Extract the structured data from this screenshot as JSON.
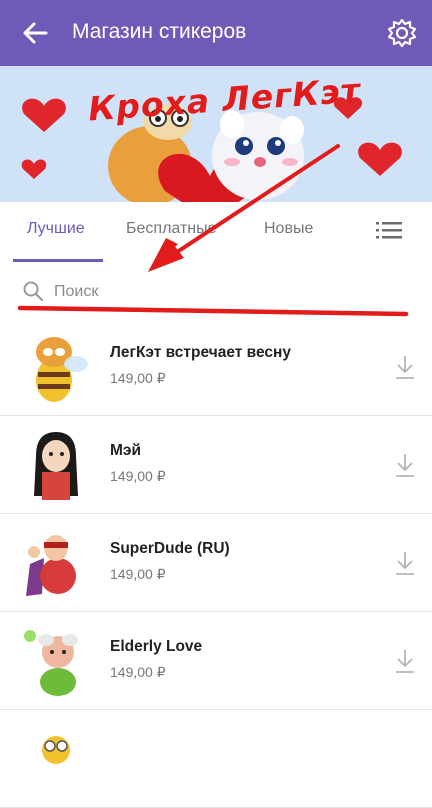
{
  "header": {
    "title": "Магазин стикеров",
    "back_icon": "arrow-left-icon",
    "settings_icon": "gear-icon"
  },
  "banner": {
    "title": "Кроха ЛегКэт"
  },
  "tabs": [
    {
      "label": "Лучшие",
      "active": true
    },
    {
      "label": "Бесплатные",
      "active": false
    },
    {
      "label": "Новые",
      "active": false
    }
  ],
  "search": {
    "placeholder": "Поиск"
  },
  "stickers": [
    {
      "name": "ЛегКэт встречает весну",
      "price": "149,00 ₽"
    },
    {
      "name": "Мэй",
      "price": "149,00 ₽"
    },
    {
      "name": "SuperDude (RU)",
      "price": "149,00 ₽"
    },
    {
      "name": "Elderly Love",
      "price": "149,00 ₽"
    }
  ],
  "colors": {
    "accent": "#6e5bb8",
    "annotation": "#e21b1b"
  }
}
